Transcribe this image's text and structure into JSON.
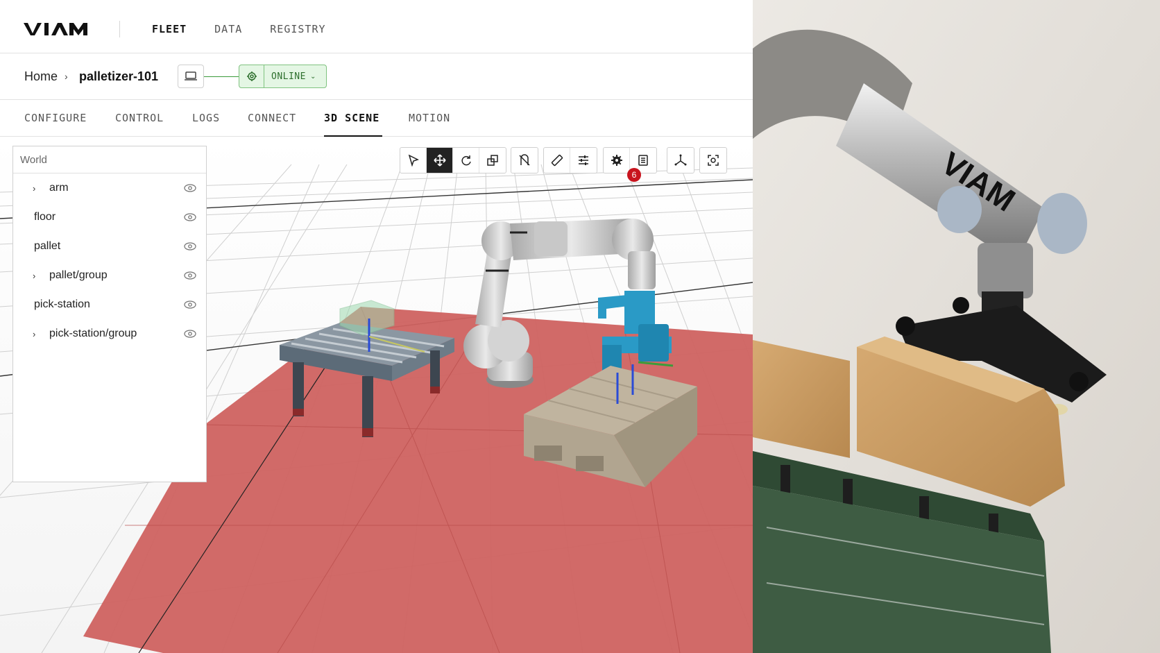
{
  "brand": {
    "logo_text": "VIAM"
  },
  "nav": {
    "items": [
      "FLEET",
      "DATA",
      "REGISTRY"
    ],
    "active": "FLEET"
  },
  "breadcrumb": {
    "home": "Home",
    "machine": "palletizer-101"
  },
  "status": {
    "label": "ONLINE",
    "color": "#2c6e2c"
  },
  "tabs": [
    {
      "label": "CONFIGURE"
    },
    {
      "label": "CONTROL"
    },
    {
      "label": "LOGS"
    },
    {
      "label": "CONNECT"
    },
    {
      "label": "3D SCENE"
    },
    {
      "label": "MOTION"
    }
  ],
  "active_tab": "3D SCENE",
  "tree": {
    "title": "World",
    "items": [
      {
        "label": "arm",
        "expandable": true
      },
      {
        "label": "floor",
        "expandable": false
      },
      {
        "label": "pallet",
        "expandable": false
      },
      {
        "label": "pallet/group",
        "expandable": true
      },
      {
        "label": "pick-station",
        "expandable": false
      },
      {
        "label": "pick-station/group",
        "expandable": true
      }
    ]
  },
  "toolbar": {
    "groups": [
      [
        "pointer-icon",
        "move-icon",
        "rotate-icon",
        "scale-icon"
      ],
      [
        "snap-off-icon"
      ],
      [
        "ruler-icon",
        "sliders-icon"
      ],
      [
        "settings-icon",
        "logs-icon"
      ],
      [
        "axes-icon"
      ],
      [
        "focus-icon"
      ]
    ],
    "active_tool": "move-icon",
    "notification_count": "6"
  },
  "photo": {
    "arm_text": "VIAM"
  },
  "colors": {
    "accent": "#111111",
    "floor": "#cf6260",
    "online_bg": "#e4f6e4",
    "gripper": "#2a9ac6",
    "badge": "#c8141e"
  }
}
